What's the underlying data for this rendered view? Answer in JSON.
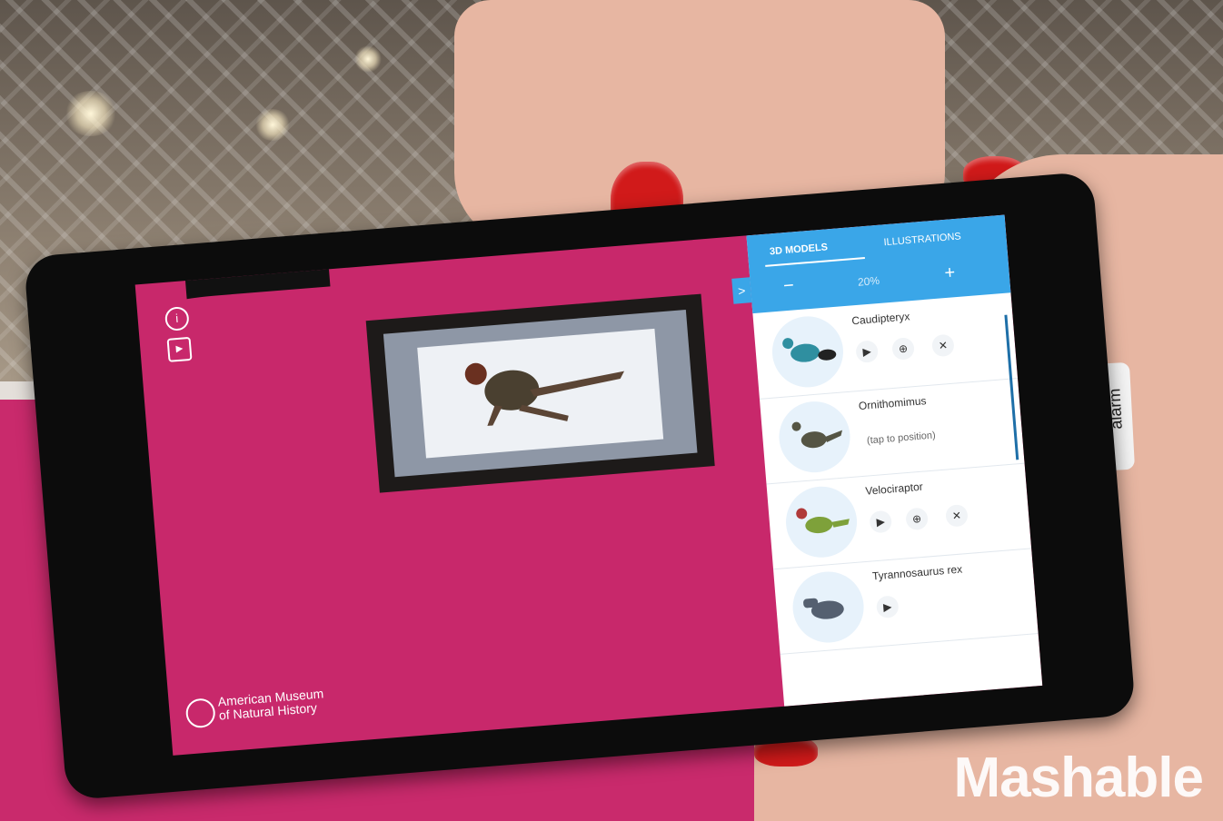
{
  "app": {
    "panel_tabs": [
      "3D MODELS",
      "ILLUSTRATIONS"
    ],
    "zoom": {
      "minus": "−",
      "value": "20%",
      "plus": "+"
    },
    "collapse_label": ">",
    "hud": {
      "info_label": "i",
      "video_label": "▶"
    },
    "museum": {
      "line1": "American Museum",
      "line2": "of Natural History"
    },
    "items": [
      {
        "name": "Caudipteryx",
        "hint": "",
        "controls": true
      },
      {
        "name": "Ornithomimus",
        "hint": "(tap to position)",
        "controls": false
      },
      {
        "name": "Velociraptor",
        "hint": "",
        "controls": true
      },
      {
        "name": "Tyrannosaurus rex",
        "hint": "",
        "controls": true
      }
    ],
    "controls": {
      "play": "▶",
      "add": "⊕",
      "remove": "✕"
    }
  },
  "scene": {
    "earbud_text": "alarm",
    "watermark": "Mashable"
  },
  "colors": {
    "wall_pink": "#c92a6c",
    "panel_blue": "#3aa6e8",
    "nail_red": "#d11a1a"
  }
}
